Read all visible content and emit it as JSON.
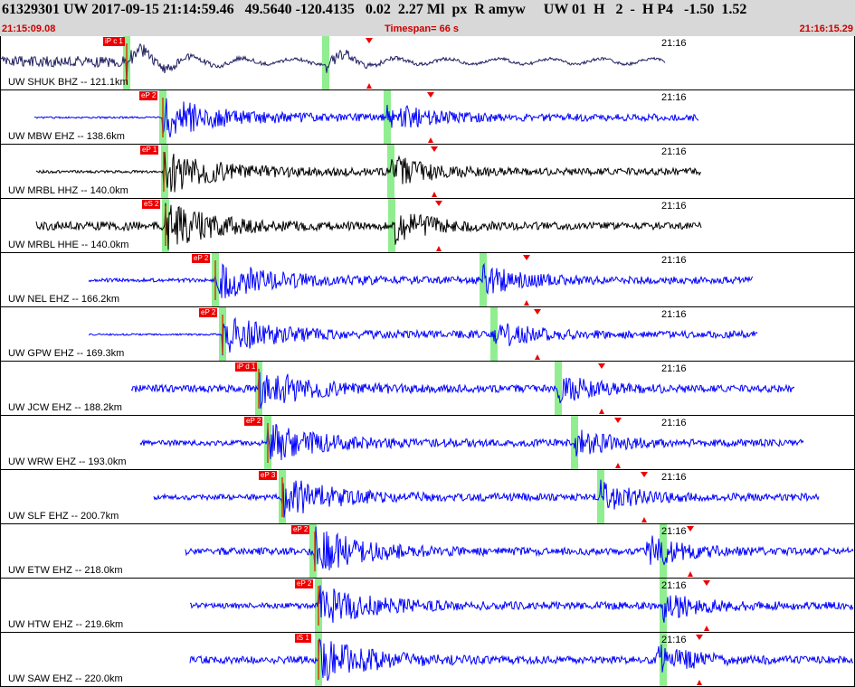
{
  "header": {
    "title": "61329301 UW 2017-09-15 21:14:59.46   49.5640 -120.4135   0.02  2.27 Ml  px  R amyw     UW 01  H   2  -  H P4   -1.50  1.52",
    "start_time": "21:15:09.08",
    "timespan": "Timespan=  66 s",
    "end_time": "21:16:15.29"
  },
  "colors": {
    "header_bg": "#d8d8d8",
    "time_text": "#cc0000",
    "pick": "#ee0000",
    "window": "#90ee90"
  },
  "channels": [
    {
      "label": "UW SHUK BHZ -- 121.1km",
      "minute": "21:16",
      "pick": "iP c 1",
      "color": "#202060"
    },
    {
      "label": "UW MBW EHZ -- 138.6km",
      "minute": "21:16",
      "pick": "eP 2",
      "color": "#0000ff"
    },
    {
      "label": "UW MRBL HHZ -- 140.0km",
      "minute": "21:16",
      "pick": "eP 1",
      "color": "#000000"
    },
    {
      "label": "UW MRBL HHE -- 140.0km",
      "minute": "21:16",
      "pick": "eS 2",
      "color": "#000000"
    },
    {
      "label": "UW NEL EHZ -- 166.2km",
      "minute": "21:16",
      "pick": "eP 2",
      "color": "#0000ff"
    },
    {
      "label": "UW GPW EHZ -- 169.3km",
      "minute": "21:16",
      "pick": "eP 2",
      "color": "#0000ff"
    },
    {
      "label": "UW JCW EHZ -- 188.2km",
      "minute": "21:16",
      "pick": "iP d 1",
      "color": "#0000ff"
    },
    {
      "label": "UW WRW EHZ -- 193.0km",
      "minute": "21:16",
      "pick": "eP 2",
      "color": "#0000ff"
    },
    {
      "label": "UW SLF EHZ -- 200.7km",
      "minute": "21:16",
      "pick": "eP 3",
      "color": "#0000ff"
    },
    {
      "label": "UW ETW EHZ -- 218.0km",
      "minute": "21:16",
      "pick": "eP 2",
      "color": "#0000ff"
    },
    {
      "label": "UW HTW EHZ -- 219.6km",
      "minute": "21:16",
      "pick": "eP 2",
      "color": "#0000ff"
    },
    {
      "label": "UW SAW EHZ -- 220.0km",
      "minute": "21:16",
      "pick": "iS 1",
      "color": "#0000ff"
    }
  ]
}
